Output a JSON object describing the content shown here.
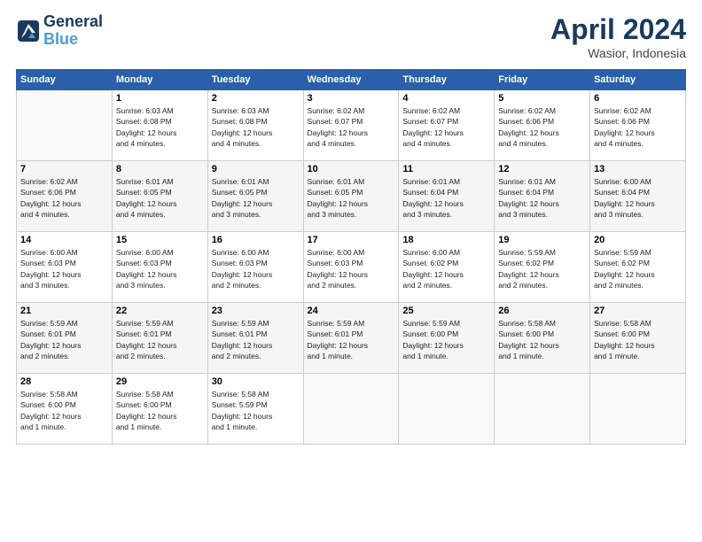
{
  "header": {
    "logo_line1": "General",
    "logo_line2": "Blue",
    "month": "April 2024",
    "location": "Wasior, Indonesia"
  },
  "days_of_week": [
    "Sunday",
    "Monday",
    "Tuesday",
    "Wednesday",
    "Thursday",
    "Friday",
    "Saturday"
  ],
  "weeks": [
    [
      {
        "day": "",
        "info": ""
      },
      {
        "day": "1",
        "info": "Sunrise: 6:03 AM\nSunset: 6:08 PM\nDaylight: 12 hours\nand 4 minutes."
      },
      {
        "day": "2",
        "info": "Sunrise: 6:03 AM\nSunset: 6:08 PM\nDaylight: 12 hours\nand 4 minutes."
      },
      {
        "day": "3",
        "info": "Sunrise: 6:02 AM\nSunset: 6:07 PM\nDaylight: 12 hours\nand 4 minutes."
      },
      {
        "day": "4",
        "info": "Sunrise: 6:02 AM\nSunset: 6:07 PM\nDaylight: 12 hours\nand 4 minutes."
      },
      {
        "day": "5",
        "info": "Sunrise: 6:02 AM\nSunset: 6:06 PM\nDaylight: 12 hours\nand 4 minutes."
      },
      {
        "day": "6",
        "info": "Sunrise: 6:02 AM\nSunset: 6:06 PM\nDaylight: 12 hours\nand 4 minutes."
      }
    ],
    [
      {
        "day": "7",
        "info": "Sunrise: 6:02 AM\nSunset: 6:06 PM\nDaylight: 12 hours\nand 4 minutes."
      },
      {
        "day": "8",
        "info": "Sunrise: 6:01 AM\nSunset: 6:05 PM\nDaylight: 12 hours\nand 4 minutes."
      },
      {
        "day": "9",
        "info": "Sunrise: 6:01 AM\nSunset: 6:05 PM\nDaylight: 12 hours\nand 3 minutes."
      },
      {
        "day": "10",
        "info": "Sunrise: 6:01 AM\nSunset: 6:05 PM\nDaylight: 12 hours\nand 3 minutes."
      },
      {
        "day": "11",
        "info": "Sunrise: 6:01 AM\nSunset: 6:04 PM\nDaylight: 12 hours\nand 3 minutes."
      },
      {
        "day": "12",
        "info": "Sunrise: 6:01 AM\nSunset: 6:04 PM\nDaylight: 12 hours\nand 3 minutes."
      },
      {
        "day": "13",
        "info": "Sunrise: 6:00 AM\nSunset: 6:04 PM\nDaylight: 12 hours\nand 3 minutes."
      }
    ],
    [
      {
        "day": "14",
        "info": "Sunrise: 6:00 AM\nSunset: 6:03 PM\nDaylight: 12 hours\nand 3 minutes."
      },
      {
        "day": "15",
        "info": "Sunrise: 6:00 AM\nSunset: 6:03 PM\nDaylight: 12 hours\nand 3 minutes."
      },
      {
        "day": "16",
        "info": "Sunrise: 6:00 AM\nSunset: 6:03 PM\nDaylight: 12 hours\nand 2 minutes."
      },
      {
        "day": "17",
        "info": "Sunrise: 6:00 AM\nSunset: 6:03 PM\nDaylight: 12 hours\nand 2 minutes."
      },
      {
        "day": "18",
        "info": "Sunrise: 6:00 AM\nSunset: 6:02 PM\nDaylight: 12 hours\nand 2 minutes."
      },
      {
        "day": "19",
        "info": "Sunrise: 5:59 AM\nSunset: 6:02 PM\nDaylight: 12 hours\nand 2 minutes."
      },
      {
        "day": "20",
        "info": "Sunrise: 5:59 AM\nSunset: 6:02 PM\nDaylight: 12 hours\nand 2 minutes."
      }
    ],
    [
      {
        "day": "21",
        "info": "Sunrise: 5:59 AM\nSunset: 6:01 PM\nDaylight: 12 hours\nand 2 minutes."
      },
      {
        "day": "22",
        "info": "Sunrise: 5:59 AM\nSunset: 6:01 PM\nDaylight: 12 hours\nand 2 minutes."
      },
      {
        "day": "23",
        "info": "Sunrise: 5:59 AM\nSunset: 6:01 PM\nDaylight: 12 hours\nand 2 minutes."
      },
      {
        "day": "24",
        "info": "Sunrise: 5:59 AM\nSunset: 6:01 PM\nDaylight: 12 hours\nand 1 minute."
      },
      {
        "day": "25",
        "info": "Sunrise: 5:59 AM\nSunset: 6:00 PM\nDaylight: 12 hours\nand 1 minute."
      },
      {
        "day": "26",
        "info": "Sunrise: 5:58 AM\nSunset: 6:00 PM\nDaylight: 12 hours\nand 1 minute."
      },
      {
        "day": "27",
        "info": "Sunrise: 5:58 AM\nSunset: 6:00 PM\nDaylight: 12 hours\nand 1 minute."
      }
    ],
    [
      {
        "day": "28",
        "info": "Sunrise: 5:58 AM\nSunset: 6:00 PM\nDaylight: 12 hours\nand 1 minute."
      },
      {
        "day": "29",
        "info": "Sunrise: 5:58 AM\nSunset: 6:00 PM\nDaylight: 12 hours\nand 1 minute."
      },
      {
        "day": "30",
        "info": "Sunrise: 5:58 AM\nSunset: 5:59 PM\nDaylight: 12 hours\nand 1 minute."
      },
      {
        "day": "",
        "info": ""
      },
      {
        "day": "",
        "info": ""
      },
      {
        "day": "",
        "info": ""
      },
      {
        "day": "",
        "info": ""
      }
    ]
  ]
}
